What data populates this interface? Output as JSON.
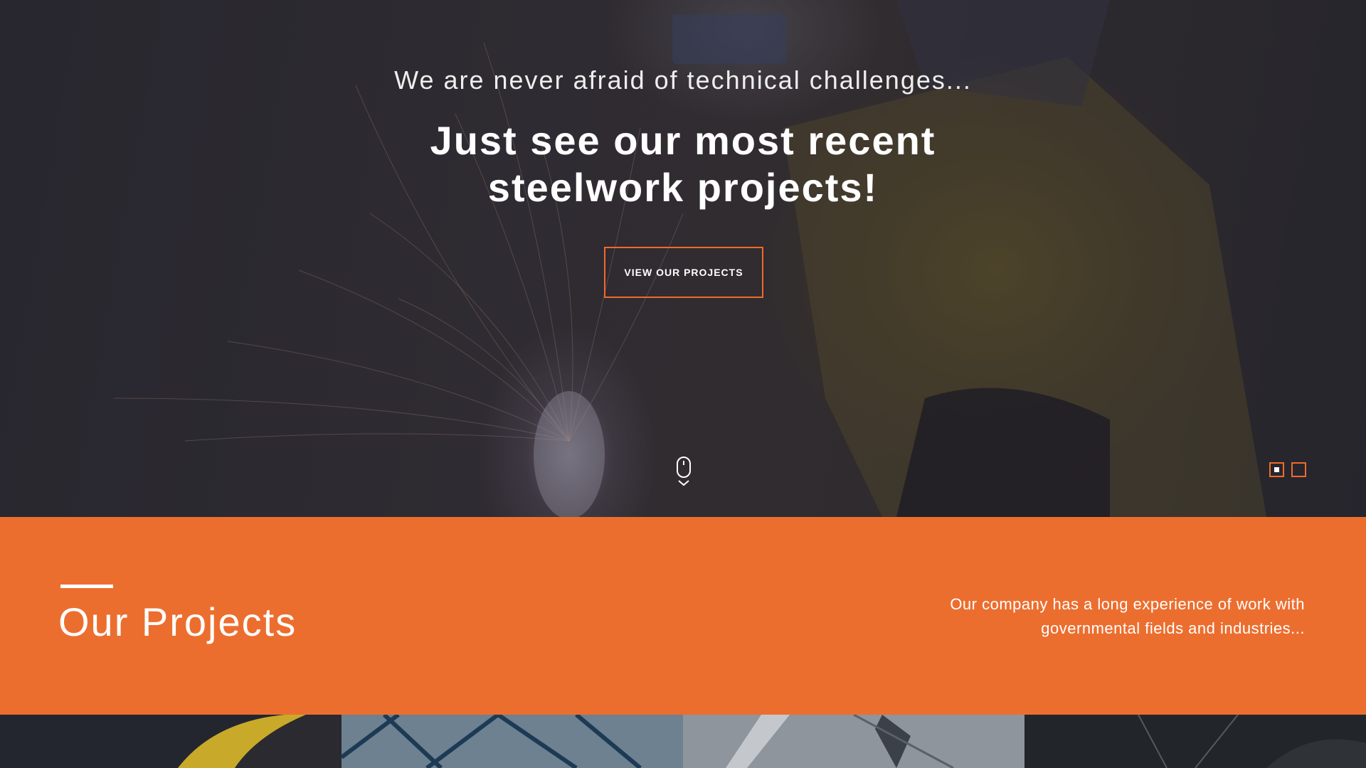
{
  "hero": {
    "subtitle": "We are never afraid of technical challenges...",
    "title": "Just see our most recent steelwork projects!",
    "button_label": "VIEW OUR PROJECTS",
    "scroll_icon": "mouse-scroll-icon",
    "slides": [
      {
        "active": true
      },
      {
        "active": false
      }
    ]
  },
  "projects_section": {
    "heading": "Our Projects",
    "description": "Our company has a long experience of work with governmental fields and industries..."
  },
  "colors": {
    "accent": "#ec6e2f",
    "button_border": "#f0692c",
    "text": "#ffffff",
    "dark_bg": "#1e222b"
  }
}
